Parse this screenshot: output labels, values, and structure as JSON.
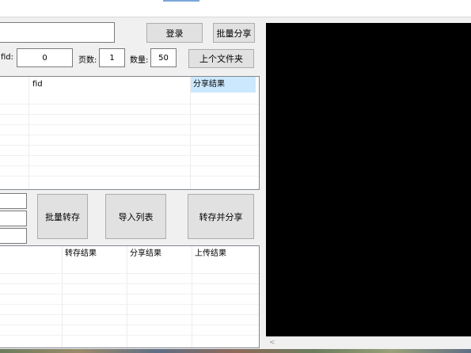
{
  "buttons": {
    "login": "登录",
    "batch_share": "批量分享",
    "parent_folder": "上个文件夹",
    "batch_transfer": "批量转存",
    "import_list": "导入列表",
    "transfer_share": "转存并分享"
  },
  "top_form": {
    "fid_label": "fid:",
    "fid_value": "0",
    "pages_label": "页数:",
    "pages_value": "1",
    "count_label": "数量:",
    "count_value": "50"
  },
  "file_table": {
    "columns": [
      "fid",
      "分享结果"
    ]
  },
  "result_table": {
    "columns": [
      "转存结果",
      "分享结果",
      "上传结果"
    ]
  },
  "preview": {
    "scroll_arrow": "<"
  }
}
